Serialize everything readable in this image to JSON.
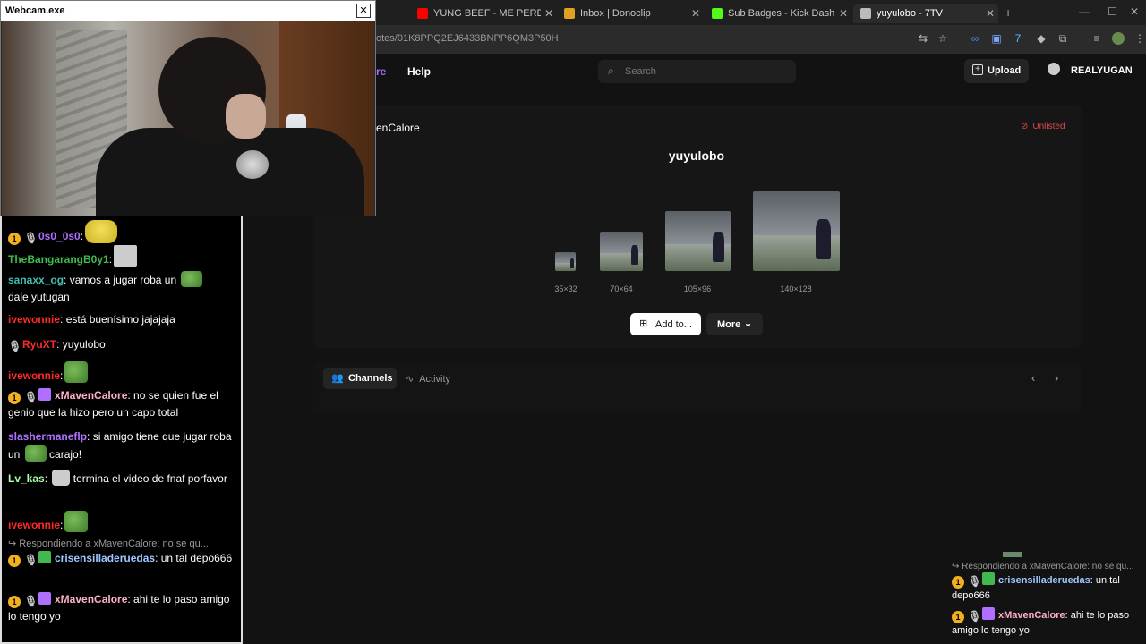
{
  "browser": {
    "tabs": [
      {
        "title": "YUNG BEEF - ME PERDI EN MA",
        "favicon_color": "#ff0000",
        "active": false
      },
      {
        "title": "Inbox | Donoclip",
        "favicon_color": "#e0a020",
        "active": false
      },
      {
        "title": "Sub Badges - Kick Dashboard",
        "favicon_color": "#53fc18",
        "active": false
      },
      {
        "title": "yuyulobo - 7TV",
        "favicon_color": "#bbbbbb",
        "active": true
      }
    ],
    "new_tab": "+",
    "url": "otes/01K8PPQ2EJ6433BNPP6QM3P50H"
  },
  "site": {
    "nav_explore": "re",
    "nav_help": "Help",
    "search_placeholder": "Search",
    "upload_label": "Upload",
    "username": "REALYUGAN"
  },
  "emote": {
    "owner": "enCalore",
    "status": "Unlisted",
    "name": "yuyulobo",
    "sizes": [
      "35×32",
      "70×64",
      "105×96",
      "140×128"
    ],
    "add_label": "Add to...",
    "more_label": "More"
  },
  "section_tabs": {
    "channels": "Channels",
    "activity": "Activity"
  },
  "webcam": {
    "title": "Webcam.exe"
  },
  "chat": [
    {
      "user": "0s0_0s0",
      "color": "#b070ff",
      "sep": ":",
      "text": ""
    },
    {
      "user": "TheBangarangB0y1",
      "color": "#3fb950",
      "sep": ":",
      "text": ""
    },
    {
      "user": "sanaxx_og",
      "color": "#40c0b0",
      "sep": ":",
      "text": " vamos a jugar roba un",
      "text2": "dale yutugan"
    },
    {
      "user": "ivewonnie",
      "color": "#ff2a2a",
      "sep": ":",
      "text": " está buenísimo jajajaja"
    },
    {
      "user": "RyuXT",
      "color": "#ff2a2a",
      "sep": ":",
      "text": " yuyulobo"
    },
    {
      "user": "ivewonnie",
      "color": "#ff2a2a",
      "sep": ":",
      "text": ""
    },
    {
      "user": "xMavenCalore",
      "color": "#ffb0c8",
      "sep": ":",
      "text": " no se quien fue el genio que la hizo pero un capo total"
    },
    {
      "user": "slashermaneflp",
      "color": "#b070ff",
      "sep": ":",
      "text": " si amigo tiene que jugar roba un",
      "text2": "carajo!"
    },
    {
      "user": "Lv_kas",
      "color": "#aaffaa",
      "sep": ":",
      "text": "termina el video de fnaf porfavor"
    },
    {
      "user": "ivewonnie",
      "color": "#ff2a2a",
      "sep": ":",
      "text": ""
    },
    {
      "user": "crisensilladeruedas",
      "color": "#9ec8ff",
      "sep": ":",
      "text": " un tal depo666"
    },
    {
      "user": "xMavenCalore",
      "color": "#ffb0c8",
      "sep": ":",
      "text": " ahi te lo paso amigo lo tengo yo"
    }
  ],
  "chat_reply_hint": "↪ Respondiendo a xMavenCalore: no se qu...",
  "chat2_reply_hint": "↪ Respondiendo a xMavenCalore: no se qu...",
  "badge_number": "1"
}
